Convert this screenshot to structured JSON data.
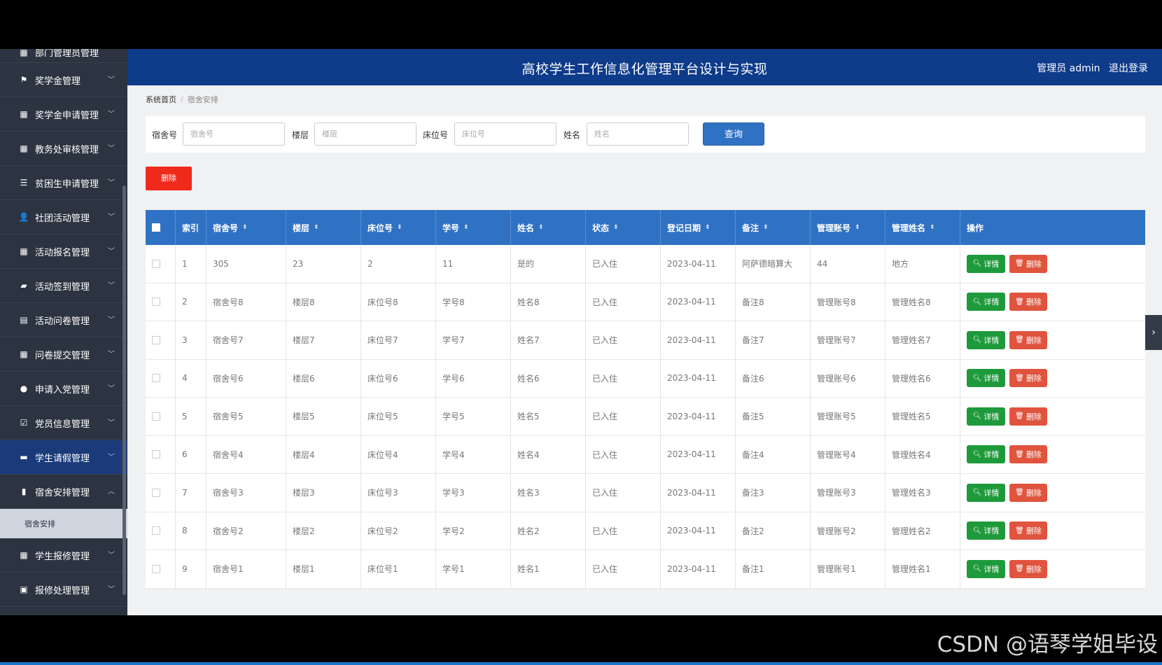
{
  "header": {
    "title": "高校学生工作信息化管理平台设计与实现",
    "user_label": "管理员 admin",
    "logout": "退出登录"
  },
  "sidebar": {
    "partial_top": "部门管理员管理",
    "items": [
      {
        "label": "奖学金管理",
        "icon": "flag-icon",
        "glyph": "⚑"
      },
      {
        "label": "奖学金申请管理",
        "icon": "grid-icon",
        "glyph": "▦"
      },
      {
        "label": "教务处审核管理",
        "icon": "grid-icon",
        "glyph": "▦"
      },
      {
        "label": "贫困生申请管理",
        "icon": "list-icon",
        "glyph": "☰"
      },
      {
        "label": "社团活动管理",
        "icon": "user-icon",
        "glyph": "👤"
      },
      {
        "label": "活动报名管理",
        "icon": "grid-icon",
        "glyph": "▦"
      },
      {
        "label": "活动签到管理",
        "icon": "comment-icon",
        "glyph": "▰"
      },
      {
        "label": "活动问卷管理",
        "icon": "clipboard-icon",
        "glyph": "▤"
      },
      {
        "label": "问卷提交管理",
        "icon": "grid-icon",
        "glyph": "▦"
      },
      {
        "label": "申请入党管理",
        "icon": "bulb-icon",
        "glyph": "●"
      },
      {
        "label": "党员信息管理",
        "icon": "check-icon",
        "glyph": "☑"
      },
      {
        "label": "学生请假管理",
        "icon": "chat-icon",
        "glyph": "▬"
      },
      {
        "label": "宿舍安排管理",
        "icon": "chart-icon",
        "glyph": "▮"
      },
      {
        "label": "学生报修管理",
        "icon": "grid-icon",
        "glyph": "▦"
      },
      {
        "label": "报修处理管理",
        "icon": "briefcase-icon",
        "glyph": "▣"
      }
    ],
    "sub_item": "宿舍安排"
  },
  "breadcrumb": {
    "home": "系统首页",
    "current": "宿舍安排"
  },
  "search": {
    "fields": [
      {
        "label": "宿舍号",
        "placeholder": "宿舍号"
      },
      {
        "label": "楼层",
        "placeholder": "楼层"
      },
      {
        "label": "床位号",
        "placeholder": "床位号"
      },
      {
        "label": "姓名",
        "placeholder": "姓名"
      }
    ],
    "button": "查询"
  },
  "toolbar": {
    "delete": "删除"
  },
  "table": {
    "columns": [
      "索引",
      "宿舍号",
      "楼层",
      "床位号",
      "学号",
      "姓名",
      "状态",
      "登记日期",
      "备注",
      "管理账号",
      "管理姓名",
      "操作"
    ],
    "detail_label": "详情",
    "delete_label": "删除",
    "rows": [
      [
        "1",
        "305",
        "23",
        "2",
        "11",
        "是的",
        "已入住",
        "2023-04-11",
        "阿萨德暗算大",
        "44",
        "地方"
      ],
      [
        "2",
        "宿舍号8",
        "楼层8",
        "床位号8",
        "学号8",
        "姓名8",
        "已入住",
        "2023-04-11",
        "备注8",
        "管理账号8",
        "管理姓名8"
      ],
      [
        "3",
        "宿舍号7",
        "楼层7",
        "床位号7",
        "学号7",
        "姓名7",
        "已入住",
        "2023-04-11",
        "备注7",
        "管理账号7",
        "管理姓名7"
      ],
      [
        "4",
        "宿舍号6",
        "楼层6",
        "床位号6",
        "学号6",
        "姓名6",
        "已入住",
        "2023-04-11",
        "备注6",
        "管理账号6",
        "管理姓名6"
      ],
      [
        "5",
        "宿舍号5",
        "楼层5",
        "床位号5",
        "学号5",
        "姓名5",
        "已入住",
        "2023-04-11",
        "备注5",
        "管理账号5",
        "管理姓名5"
      ],
      [
        "6",
        "宿舍号4",
        "楼层4",
        "床位号4",
        "学号4",
        "姓名4",
        "已入住",
        "2023-04-11",
        "备注4",
        "管理账号4",
        "管理姓名4"
      ],
      [
        "7",
        "宿舍号3",
        "楼层3",
        "床位号3",
        "学号3",
        "姓名3",
        "已入住",
        "2023-04-11",
        "备注3",
        "管理账号3",
        "管理姓名3"
      ],
      [
        "8",
        "宿舍号2",
        "楼层2",
        "床位号2",
        "学号2",
        "姓名2",
        "已入住",
        "2023-04-11",
        "备注2",
        "管理账号2",
        "管理姓名2"
      ],
      [
        "9",
        "宿舍号1",
        "楼层1",
        "床位号1",
        "学号1",
        "姓名1",
        "已入住",
        "2023-04-11",
        "备注1",
        "管理账号1",
        "管理姓名1"
      ]
    ]
  },
  "watermark": "CSDN @语琴学姐毕设",
  "colors": {
    "header": "#0e3b8a",
    "table_head": "#2f72c4",
    "delete": "#f02a1b",
    "detail": "#1e9a3a"
  }
}
